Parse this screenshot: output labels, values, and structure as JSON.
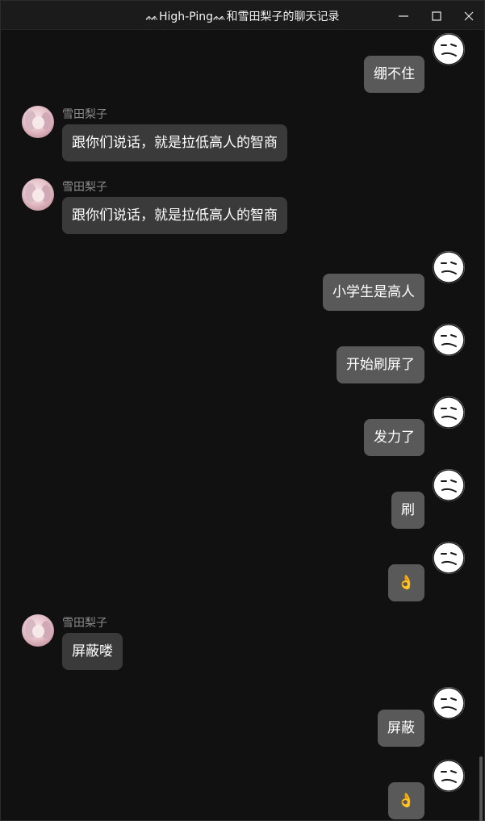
{
  "window": {
    "title": "ᨐHigh-Pingᨐ和雪田梨子的聊天记录",
    "minimize_icon": "minimize-icon",
    "maximize_icon": "maximize-icon",
    "close_icon": "close-icon"
  },
  "contacts": {
    "me_avatar_icon": "neutral-face-icon",
    "other_name": "雪田梨子"
  },
  "messages": [
    {
      "from": "me",
      "text": "绷不住"
    },
    {
      "from": "other",
      "name": "雪田梨子",
      "text": "跟你们说话，就是拉低高人的智商"
    },
    {
      "from": "other",
      "name": "雪田梨子",
      "text": "跟你们说话，就是拉低高人的智商"
    },
    {
      "from": "me",
      "text": "小学生是高人"
    },
    {
      "from": "me",
      "text": "开始刷屏了"
    },
    {
      "from": "me",
      "text": "发力了"
    },
    {
      "from": "me",
      "text": "刷"
    },
    {
      "from": "me",
      "text": "👌"
    },
    {
      "from": "other",
      "name": "雪田梨子",
      "text": "屏蔽喽"
    },
    {
      "from": "me",
      "text": "屏蔽"
    },
    {
      "from": "me",
      "text": "👌"
    }
  ],
  "colors": {
    "background": "#111111",
    "bubble_me": "#595959",
    "bubble_other": "#3a3a3a",
    "name_text": "#8c8c8c"
  }
}
